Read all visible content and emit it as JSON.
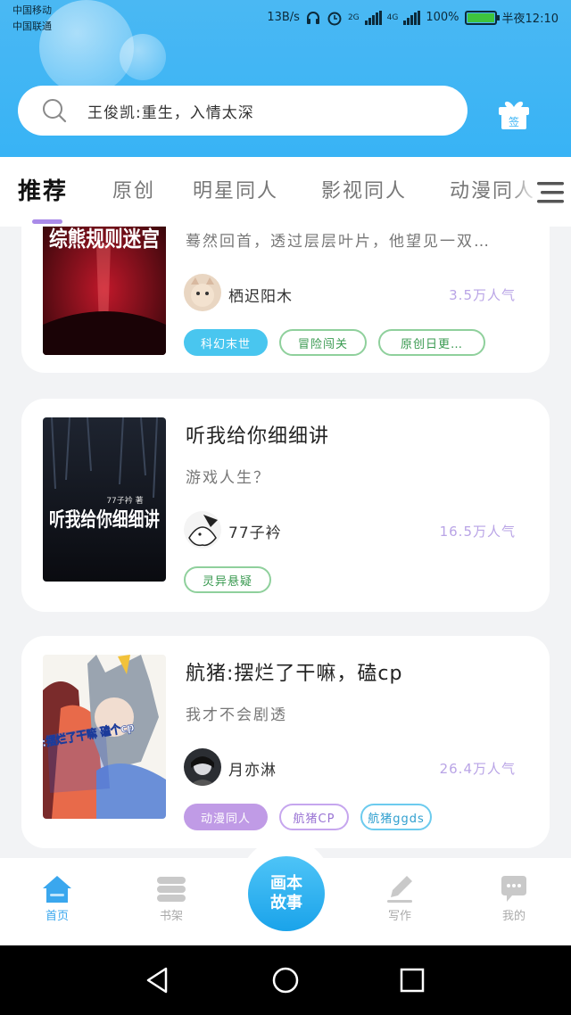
{
  "status_bar": {
    "carrier_1": "中国移动",
    "carrier_2": "中国联通",
    "speed": "13B/s",
    "net_2g": "2G",
    "net_4g": "4G",
    "battery": "100%",
    "time": "半夜12:10"
  },
  "search": {
    "placeholder": "王俊凯:重生，入情太深"
  },
  "header": {
    "gift_label": "签"
  },
  "tabs": [
    {
      "label": "推荐",
      "active": true
    },
    {
      "label": "原创"
    },
    {
      "label": "明星同人"
    },
    {
      "label": "影视同人"
    },
    {
      "label": "动漫同人"
    }
  ],
  "books": [
    {
      "cover_text": "综熊规则迷宫",
      "desc": "蓦然回首，透过层层叶片，他望见一双…",
      "author": "栖迟阳木",
      "popularity": "3.5万人气",
      "tags": [
        "科幻末世",
        "冒险闯关",
        "原创日更…"
      ]
    },
    {
      "title": "听我给你细细讲",
      "cover_text": "听我给你细细讲",
      "cover_sub": "77子衿 著",
      "desc": "游戏人生？",
      "author": "77子衿",
      "popularity": "16.5万人气",
      "tags": [
        "灵异悬疑"
      ]
    },
    {
      "title": "航猪:摆烂了干嘛，磕cp",
      "cover_text": "航猪:摆烂了干嘛 磕个cp",
      "desc": "我才不会剧透",
      "author": "月亦淋",
      "popularity": "26.4万人气",
      "tags": [
        "动漫同人",
        "航猪CP",
        "航猪ggds"
      ]
    }
  ],
  "bottom_nav": {
    "home": "首页",
    "shelf": "书架",
    "center": "画本故事",
    "write": "写作",
    "mine": "我的"
  },
  "colors": {
    "header_blue": "#38b3f5",
    "accent_purple": "#a98ae8",
    "nav_active": "#3aa7ee"
  }
}
